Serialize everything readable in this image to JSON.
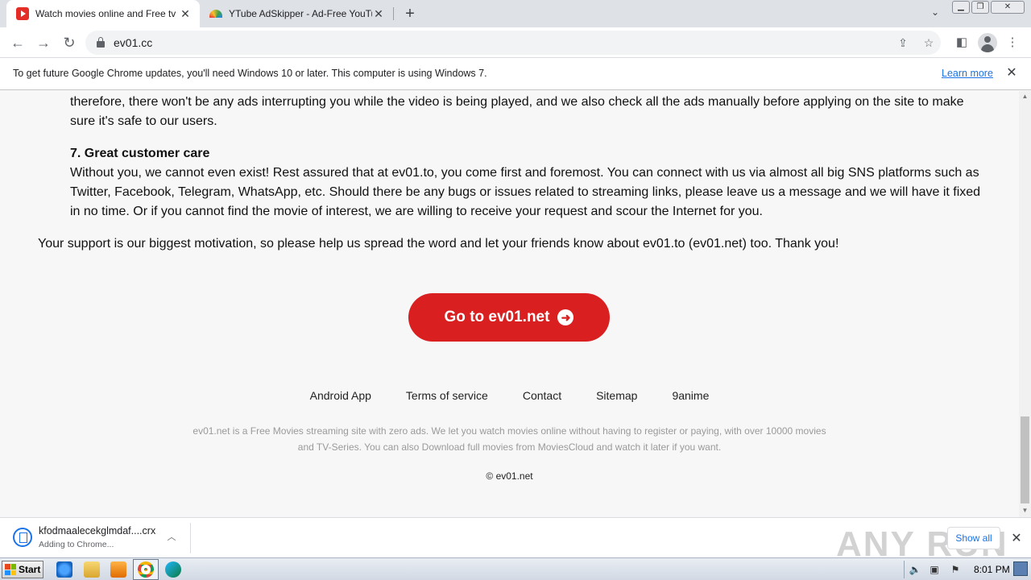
{
  "browser": {
    "tabs": [
      {
        "title": "Watch movies online and Free tv sho",
        "favicon": "youtube-icon",
        "active": true
      },
      {
        "title": "YTube AdSkipper - Ad-Free YouTube",
        "favicon": "rainbow-icon",
        "active": false
      }
    ],
    "address_bar": {
      "url": "ev01.cc"
    }
  },
  "infobar": {
    "message": "To get future Google Chrome updates, you'll need Windows 10 or later. This computer is using Windows 7.",
    "link": "Learn more"
  },
  "page": {
    "para_ads": "therefore, there won't be any ads interrupting you while the video is being played, and we also check all the ads manually before applying on the site to make sure it's safe to our users.",
    "heading_care": "7. Great customer care",
    "para_care": "Without you, we cannot even exist! Rest assured that at ev01.to, you come first and foremost. You can connect with us via almost all big SNS platforms such as Twitter, Facebook, Telegram, WhatsApp, etc. Should there be any bugs or issues related to streaming links, please leave us a message and we will have it fixed in no time. Or if you cannot find the movie of interest, we are willing to receive your request and scour the Internet for you.",
    "para_support": "Your support is our biggest motivation, so please help us spread the word and let your friends know about ev01.to (ev01.net) too. Thank you!",
    "cta_label": "Go to ev01.net",
    "accent_color": "#d91f1f",
    "footer_links": [
      "Android App",
      "Terms of service",
      "Contact",
      "Sitemap",
      "9anime"
    ],
    "footer_description": "ev01.net is a Free Movies streaming site with zero ads. We let you watch movies online without having to register or paying, with over 10000 movies and TV-Series. You can also Download full movies from MoviesCloud and watch it later if you want.",
    "copyright": "© ev01.net"
  },
  "downloads": {
    "filename": "kfodmaalecekglmdaf....crx",
    "status": "Adding to Chrome...",
    "show_all": "Show all",
    "watermark": "ANY RUN"
  },
  "taskbar": {
    "start_label": "Start",
    "clock": "8:01 PM"
  }
}
